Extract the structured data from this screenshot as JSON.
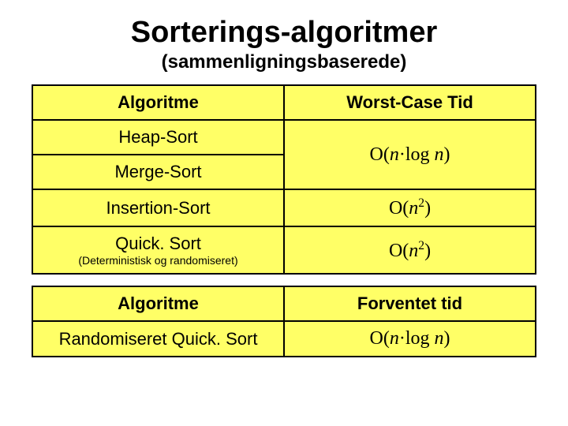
{
  "title": "Sorterings-algoritmer",
  "subtitle": "(sammenligningsbaserede)",
  "table1": {
    "h1": "Algoritme",
    "h2": "Worst-Case Tid",
    "r1c1": "Heap-Sort",
    "r2c1": "Merge-Sort",
    "r12c2_html": "O(<i>n</i>·log <i>n</i>)",
    "r3c1": "Insertion-Sort",
    "r3c2_html": "O(<i>n</i><span class='sup'>2</span>)",
    "r4c1a": "Quick. Sort",
    "r4c1b": "(Deterministisk og randomiseret)",
    "r4c2_html": "O(<i>n</i><span class='sup'>2</span>)"
  },
  "table2": {
    "h1": "Algoritme",
    "h2": "Forventet tid",
    "r1c1": "Randomiseret Quick. Sort",
    "r1c2_html": "O(<i>n</i>·log <i>n</i>)"
  }
}
